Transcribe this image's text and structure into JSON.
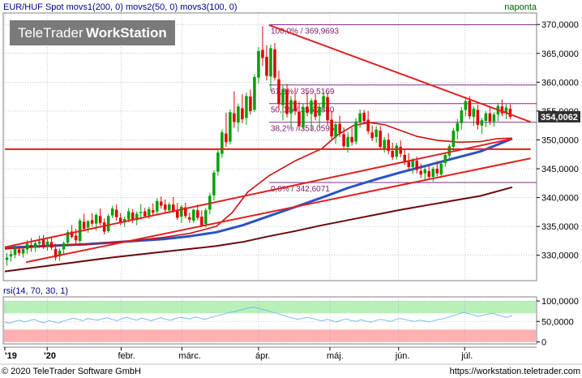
{
  "header": {
    "instrument_text": "EUR/HUF Spot movs1(200, 0) movs2(50, 0) movs3(100, 0)",
    "period": "naponta"
  },
  "watermark": {
    "part1": "TeleTrader",
    "part2": "WorkStation"
  },
  "footer": {
    "copyright": "© 2020 TeleTrader Software GmbH",
    "url": "https://workstation.teletrader.com"
  },
  "colors": {
    "grid": "#a0a0c0",
    "panel_border": "#808080",
    "up_candle": "#00a000",
    "down_candle": "#e00000",
    "ma_fast": "#cc1010",
    "ma_mid": "#2a52c8",
    "ma_slow": "#6a0a0a",
    "trend": "#e02020",
    "fib": "#8b2a8b",
    "rsi_line": "#7ab8e8",
    "rsi_high_zone": "#b8f0b8",
    "rsi_low_zone": "#ffb0b0",
    "price_tag_bg": "#303030"
  },
  "chart_data": [
    {
      "type": "candlestick",
      "title": "EUR/HUF Spot",
      "y_ticks": [
        "370,0000",
        "365,0000",
        "360,0000",
        "355,0000",
        "350,0000",
        "345,0000",
        "340,0000",
        "335,0000",
        "330,0000"
      ],
      "ylim": [
        325.6,
        372.0
      ],
      "x_labels": [
        "'19",
        "'20",
        "febr.",
        "márc.",
        "ápr.",
        "máj.",
        "jún.",
        "júl."
      ],
      "last_price": 354.0062,
      "last_price_label": "354,0062",
      "candles": [
        [
          329.2,
          330.4,
          328.2,
          329.6
        ],
        [
          329.8,
          330.9,
          328.9,
          330.2
        ],
        [
          330.1,
          331.8,
          329.5,
          331.2
        ],
        [
          331.0,
          331.6,
          329.9,
          330.4
        ],
        [
          330.3,
          331.3,
          329.6,
          331.1
        ],
        [
          331.0,
          332.6,
          330.2,
          332.0
        ],
        [
          331.8,
          333.0,
          330.6,
          331.3
        ],
        [
          331.3,
          332.7,
          330.6,
          332.1
        ],
        [
          332.0,
          333.4,
          331.2,
          332.4
        ],
        [
          332.7,
          333.5,
          331.1,
          331.4
        ],
        [
          331.6,
          333.0,
          330.8,
          332.4
        ],
        [
          332.3,
          333.1,
          330.9,
          331.3
        ],
        [
          331.1,
          332.0,
          329.1,
          329.6
        ],
        [
          329.8,
          331.2,
          329.0,
          330.8
        ],
        [
          331.0,
          332.4,
          330.2,
          332.1
        ],
        [
          332.2,
          334.4,
          331.5,
          334.0
        ],
        [
          334.1,
          335.2,
          332.9,
          333.2
        ],
        [
          333.4,
          334.6,
          332.0,
          332.6
        ],
        [
          332.5,
          336.4,
          332.0,
          336.0
        ],
        [
          335.8,
          337.2,
          334.2,
          334.6
        ],
        [
          334.8,
          336.1,
          333.9,
          335.9
        ],
        [
          336.1,
          337.3,
          335.0,
          335.5
        ],
        [
          335.5,
          337.3,
          334.3,
          337.0
        ],
        [
          336.8,
          338.1,
          335.2,
          335.6
        ],
        [
          335.7,
          336.4,
          333.6,
          334.1
        ],
        [
          334.2,
          337.2,
          333.9,
          336.8
        ],
        [
          336.9,
          338.6,
          336.4,
          338.1
        ],
        [
          337.9,
          338.8,
          336.0,
          336.6
        ],
        [
          336.5,
          337.3,
          335.2,
          335.6
        ],
        [
          335.7,
          336.7,
          334.9,
          336.3
        ],
        [
          336.2,
          338.2,
          335.7,
          337.6
        ],
        [
          337.4,
          338.0,
          335.6,
          336.1
        ],
        [
          336.1,
          337.6,
          335.2,
          337.2
        ],
        [
          337.3,
          338.9,
          336.2,
          337.5
        ],
        [
          337.6,
          338.2,
          336.5,
          336.8
        ],
        [
          336.9,
          338.4,
          336.3,
          338.0
        ],
        [
          337.8,
          339.0,
          336.9,
          337.4
        ],
        [
          337.6,
          339.9,
          337.2,
          339.4
        ],
        [
          339.3,
          340.2,
          338.1,
          338.6
        ],
        [
          338.8,
          339.7,
          337.4,
          337.9
        ],
        [
          337.8,
          339.2,
          337.2,
          338.8
        ],
        [
          338.8,
          340.1,
          337.3,
          337.6
        ],
        [
          337.8,
          339.1,
          336.1,
          336.5
        ],
        [
          336.7,
          338.7,
          335.6,
          338.4
        ],
        [
          338.3,
          339.1,
          336.4,
          336.8
        ],
        [
          336.6,
          337.4,
          335.6,
          336.2
        ],
        [
          336.0,
          338.1,
          335.6,
          337.9
        ],
        [
          337.8,
          338.8,
          336.1,
          336.5
        ],
        [
          336.7,
          337.8,
          334.9,
          335.2
        ],
        [
          335.4,
          338.2,
          334.8,
          337.8
        ],
        [
          337.9,
          340.8,
          337.1,
          340.3
        ],
        [
          340.4,
          344.7,
          339.5,
          344.3
        ],
        [
          344.5,
          348.3,
          343.8,
          347.8
        ],
        [
          347.6,
          351.8,
          346.9,
          351.3
        ],
        [
          351.1,
          354.7,
          348.8,
          349.6
        ],
        [
          349.7,
          355.3,
          349.2,
          354.8
        ],
        [
          354.6,
          358.4,
          352.1,
          353.1
        ],
        [
          353.0,
          356.3,
          351.4,
          355.8
        ],
        [
          355.5,
          357.9,
          352.9,
          353.6
        ],
        [
          353.8,
          358.2,
          352.6,
          357.6
        ],
        [
          357.5,
          358.7,
          354.4,
          355.0
        ],
        [
          355.2,
          361.4,
          354.8,
          360.9
        ],
        [
          360.8,
          366.1,
          359.8,
          365.4
        ],
        [
          365.6,
          369.7,
          362.8,
          364.2
        ],
        [
          364.4,
          366.4,
          360.3,
          361.1
        ],
        [
          361.0,
          366.5,
          358.5,
          365.9
        ],
        [
          365.7,
          366.8,
          360.3,
          360.8
        ],
        [
          360.5,
          362.0,
          355.4,
          356.2
        ],
        [
          356.0,
          359.6,
          353.4,
          358.8
        ],
        [
          358.7,
          359.7,
          353.9,
          354.5
        ],
        [
          354.6,
          357.6,
          352.2,
          356.9
        ],
        [
          356.8,
          359.0,
          354.3,
          355.0
        ],
        [
          354.9,
          356.6,
          351.6,
          352.4
        ],
        [
          352.2,
          356.3,
          351.8,
          355.6
        ],
        [
          355.7,
          358.3,
          354.1,
          354.7
        ],
        [
          354.5,
          357.2,
          351.6,
          356.8
        ],
        [
          356.9,
          358.0,
          353.4,
          354.0
        ],
        [
          354.2,
          356.3,
          352.1,
          355.7
        ],
        [
          355.6,
          358.4,
          354.9,
          357.6
        ],
        [
          357.4,
          358.2,
          352.6,
          353.4
        ],
        [
          353.5,
          355.0,
          350.1,
          350.6
        ],
        [
          350.5,
          353.2,
          349.3,
          352.7
        ],
        [
          352.8,
          354.2,
          350.5,
          351.2
        ],
        [
          351.0,
          352.2,
          348.3,
          348.9
        ],
        [
          348.8,
          351.3,
          347.8,
          350.5
        ],
        [
          350.5,
          352.1,
          349.0,
          349.6
        ],
        [
          349.7,
          353.8,
          349.2,
          353.2
        ],
        [
          353.1,
          355.3,
          352.1,
          354.6
        ],
        [
          354.7,
          355.2,
          352.8,
          353.3
        ],
        [
          353.5,
          355.0,
          351.0,
          351.5
        ],
        [
          351.3,
          352.5,
          349.8,
          350.3
        ],
        [
          350.5,
          352.4,
          349.5,
          351.8
        ],
        [
          351.6,
          352.4,
          348.3,
          348.8
        ],
        [
          348.5,
          350.5,
          347.8,
          350.0
        ],
        [
          350.0,
          351.2,
          347.5,
          348.1
        ],
        [
          348.1,
          349.5,
          346.5,
          347.0
        ],
        [
          347.1,
          349.5,
          346.6,
          349.0
        ],
        [
          348.8,
          349.9,
          347.0,
          347.6
        ],
        [
          347.4,
          348.5,
          345.6,
          346.2
        ],
        [
          346.2,
          347.7,
          344.8,
          345.3
        ],
        [
          345.3,
          346.8,
          344.1,
          346.5
        ],
        [
          346.4,
          347.1,
          344.2,
          344.8
        ],
        [
          344.6,
          345.9,
          343.4,
          344.0
        ],
        [
          344.2,
          345.3,
          343.0,
          344.9
        ],
        [
          344.6,
          345.6,
          343.2,
          343.6
        ],
        [
          343.6,
          345.4,
          342.8,
          345.0
        ],
        [
          345.0,
          346.3,
          343.7,
          344.2
        ],
        [
          344.0,
          346.4,
          343.4,
          345.9
        ],
        [
          346.0,
          347.8,
          345.3,
          347.4
        ],
        [
          347.3,
          349.3,
          346.5,
          348.9
        ],
        [
          348.8,
          352.1,
          348.0,
          351.6
        ],
        [
          351.5,
          353.6,
          350.1,
          352.9
        ],
        [
          352.9,
          355.7,
          351.8,
          355.1
        ],
        [
          355.2,
          357.4,
          354.1,
          356.7
        ],
        [
          356.8,
          357.6,
          353.6,
          354.1
        ],
        [
          354.0,
          355.8,
          352.4,
          355.4
        ],
        [
          355.2,
          356.1,
          351.8,
          352.6
        ],
        [
          352.5,
          353.8,
          351.0,
          353.4
        ],
        [
          353.3,
          355.0,
          352.2,
          354.6
        ],
        [
          354.6,
          355.6,
          352.6,
          353.2
        ],
        [
          353.2,
          354.8,
          352.3,
          354.4
        ],
        [
          354.4,
          356.4,
          353.2,
          355.9
        ],
        [
          355.8,
          357.0,
          354.1,
          354.6
        ],
        [
          354.6,
          356.2,
          353.6,
          355.6
        ],
        [
          355.4,
          356.2,
          353.6,
          354.0
        ]
      ],
      "ma_fast_200": [
        [
          0,
          331.1
        ],
        [
          0.05,
          331.4
        ],
        [
          0.1,
          331.7
        ],
        [
          0.15,
          331.9
        ],
        [
          0.2,
          332.2
        ],
        [
          0.25,
          332.6
        ],
        [
          0.3,
          333.1
        ],
        [
          0.35,
          333.8
        ],
        [
          0.4,
          335.0
        ],
        [
          0.43,
          337.4
        ],
        [
          0.46,
          341.0
        ],
        [
          0.5,
          343.8
        ],
        [
          0.55,
          346.4
        ],
        [
          0.6,
          348.5
        ],
        [
          0.63,
          350.9
        ],
        [
          0.66,
          352.5
        ],
        [
          0.69,
          353.0
        ],
        [
          0.72,
          352.6
        ],
        [
          0.75,
          351.6
        ],
        [
          0.78,
          350.6
        ],
        [
          0.82,
          349.9
        ],
        [
          0.86,
          349.6
        ],
        [
          0.9,
          349.7
        ],
        [
          0.93,
          350.2
        ],
        [
          0.96,
          350.3
        ]
      ],
      "ma_mid_100": [
        [
          0,
          331.3
        ],
        [
          0.05,
          331.5
        ],
        [
          0.1,
          331.7
        ],
        [
          0.15,
          331.9
        ],
        [
          0.2,
          332.2
        ],
        [
          0.25,
          332.5
        ],
        [
          0.3,
          332.8
        ],
        [
          0.35,
          333.3
        ],
        [
          0.4,
          334.0
        ],
        [
          0.45,
          335.2
        ],
        [
          0.5,
          336.8
        ],
        [
          0.55,
          338.4
        ],
        [
          0.6,
          340.0
        ],
        [
          0.65,
          341.7
        ],
        [
          0.7,
          343.1
        ],
        [
          0.75,
          344.4
        ],
        [
          0.8,
          345.6
        ],
        [
          0.85,
          346.8
        ],
        [
          0.9,
          348.0
        ],
        [
          0.96,
          350.2
        ]
      ],
      "ma_slow": [
        [
          0,
          327.2
        ],
        [
          0.1,
          328.4
        ],
        [
          0.2,
          329.6
        ],
        [
          0.3,
          330.6
        ],
        [
          0.4,
          331.6
        ],
        [
          0.45,
          332.3
        ],
        [
          0.5,
          333.3
        ],
        [
          0.55,
          334.2
        ],
        [
          0.6,
          335.2
        ],
        [
          0.65,
          336.1
        ],
        [
          0.7,
          337.0
        ],
        [
          0.75,
          337.9
        ],
        [
          0.8,
          338.7
        ],
        [
          0.85,
          339.5
        ],
        [
          0.9,
          340.3
        ],
        [
          0.96,
          341.8
        ]
      ],
      "trendlines": [
        {
          "from": [
            0.04,
            328.8
          ],
          "to": [
            0.995,
            346.8
          ]
        },
        {
          "from": [
            0.0,
            331.4
          ],
          "to": [
            0.96,
            350.2
          ]
        },
        {
          "from": [
            0.5,
            369.9
          ],
          "to": [
            0.995,
            353.1
          ]
        },
        {
          "from": [
            0.0,
            348.4
          ],
          "to": [
            0.995,
            348.4
          ]
        }
      ],
      "fib_levels": [
        {
          "label": "100,0% / 369,9693",
          "value": 369.9693
        },
        {
          "label": "61,8% / 359,5169",
          "value": 359.5169
        },
        {
          "label": "50,0% / 356,2880",
          "value": 356.288
        },
        {
          "label": "38,2% / 353,0595",
          "value": 353.0595
        },
        {
          "label": "0,0% / 342,6071",
          "value": 342.6071
        }
      ]
    },
    {
      "type": "line",
      "title": "rsi(14, 70, 30, 1)",
      "y_ticks": [
        "100,0000",
        "50,0000",
        "0"
      ],
      "ylim": [
        -5,
        110
      ],
      "overbought": 70,
      "oversold": 30,
      "values": [
        48,
        46,
        50,
        53,
        49,
        52,
        55,
        50,
        47,
        52,
        49,
        46,
        51,
        54,
        58,
        55,
        52,
        57,
        55,
        53,
        56,
        59,
        55,
        52,
        57,
        60,
        56,
        53,
        58,
        55,
        52,
        56,
        59,
        55,
        53,
        57,
        60,
        58,
        56,
        61,
        58,
        55,
        59,
        62,
        65,
        68,
        72,
        74,
        77,
        80,
        83,
        85,
        82,
        79,
        76,
        72,
        69,
        65,
        61,
        58,
        55,
        58,
        60,
        57,
        54,
        51,
        55,
        52,
        49,
        53,
        56,
        52,
        50,
        54,
        51,
        48,
        52,
        55,
        53,
        50,
        54,
        57,
        55,
        52,
        50,
        53,
        51,
        49,
        52,
        55,
        57,
        60,
        64,
        68,
        72,
        69,
        66,
        62,
        65,
        68,
        70,
        66,
        62,
        60,
        64
      ]
    }
  ]
}
